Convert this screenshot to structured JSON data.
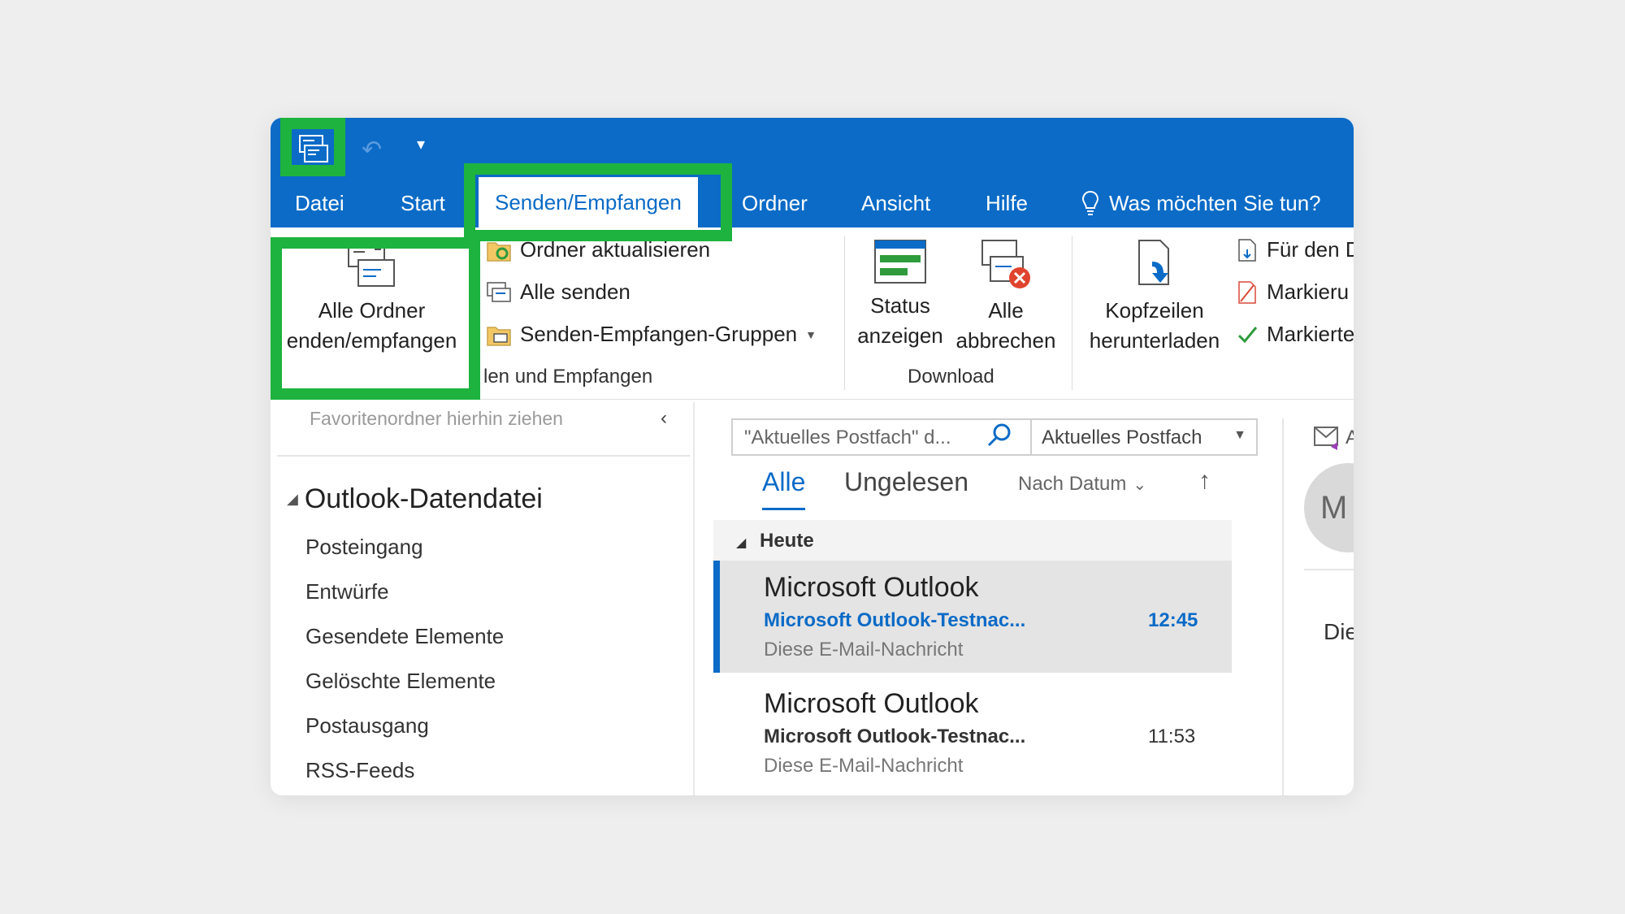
{
  "colors": {
    "accent": "#0b6bc7",
    "highlight": "#1db33e",
    "background": "#eeeeee"
  },
  "quick_access": {
    "send_all_icon": "send-receive-icon",
    "undo_icon": "undo-icon",
    "more_icon": "customize-qat-icon"
  },
  "tabs": {
    "file": "Datei",
    "start": "Start",
    "send_receive": "Senden/Empfangen",
    "folder": "Ordner",
    "view": "Ansicht",
    "help": "Hilfe",
    "tell_me": "Was möchten Sie tun?"
  },
  "ribbon": {
    "send_receive_all_line1": "Alle Ordner",
    "send_receive_all_line2": "enden/empfangen",
    "update_folder": "Ordner aktualisieren",
    "send_all": "Alle senden",
    "send_receive_groups": "Senden-Empfangen-Gruppen",
    "group_send_receive": "len und Empfangen",
    "show_progress_line1": "Status",
    "show_progress_line2": "anzeigen",
    "cancel_all_line1": "Alle",
    "cancel_all_line2": "abbrechen",
    "group_download": "Download",
    "download_headers_line1": "Kopfzeilen",
    "download_headers_line2": "herunterladen",
    "server_1": "Für den D",
    "server_2": "Markieru",
    "server_3": "Markierte"
  },
  "folder_pane": {
    "favorites_hint": "Favoritenordner hierhin ziehen",
    "datafile": "Outlook-Datendatei",
    "folders": [
      "Posteingang",
      "Entwürfe",
      "Gesendete Elemente",
      "Gelöschte Elemente",
      "Postausgang",
      "RSS-Feeds"
    ]
  },
  "mail_list": {
    "search_placeholder": "\"Aktuelles Postfach\" d...",
    "scope": "Aktuelles Postfach",
    "filter_all": "Alle",
    "filter_unread": "Ungelesen",
    "sort": "Nach Datum",
    "group": "Heute",
    "messages": [
      {
        "from": "Microsoft Outlook",
        "subject": "Microsoft Outlook-Testnac...",
        "time": "12:45",
        "preview": "Diese E-Mail-Nachricht"
      },
      {
        "from": "Microsoft Outlook",
        "subject": "Microsoft Outlook-Testnac...",
        "time": "11:53",
        "preview": "Diese E-Mail-Nachricht"
      }
    ]
  },
  "reading_pane": {
    "avatar_initials": "M",
    "text": "Die",
    "header_label": "A"
  }
}
